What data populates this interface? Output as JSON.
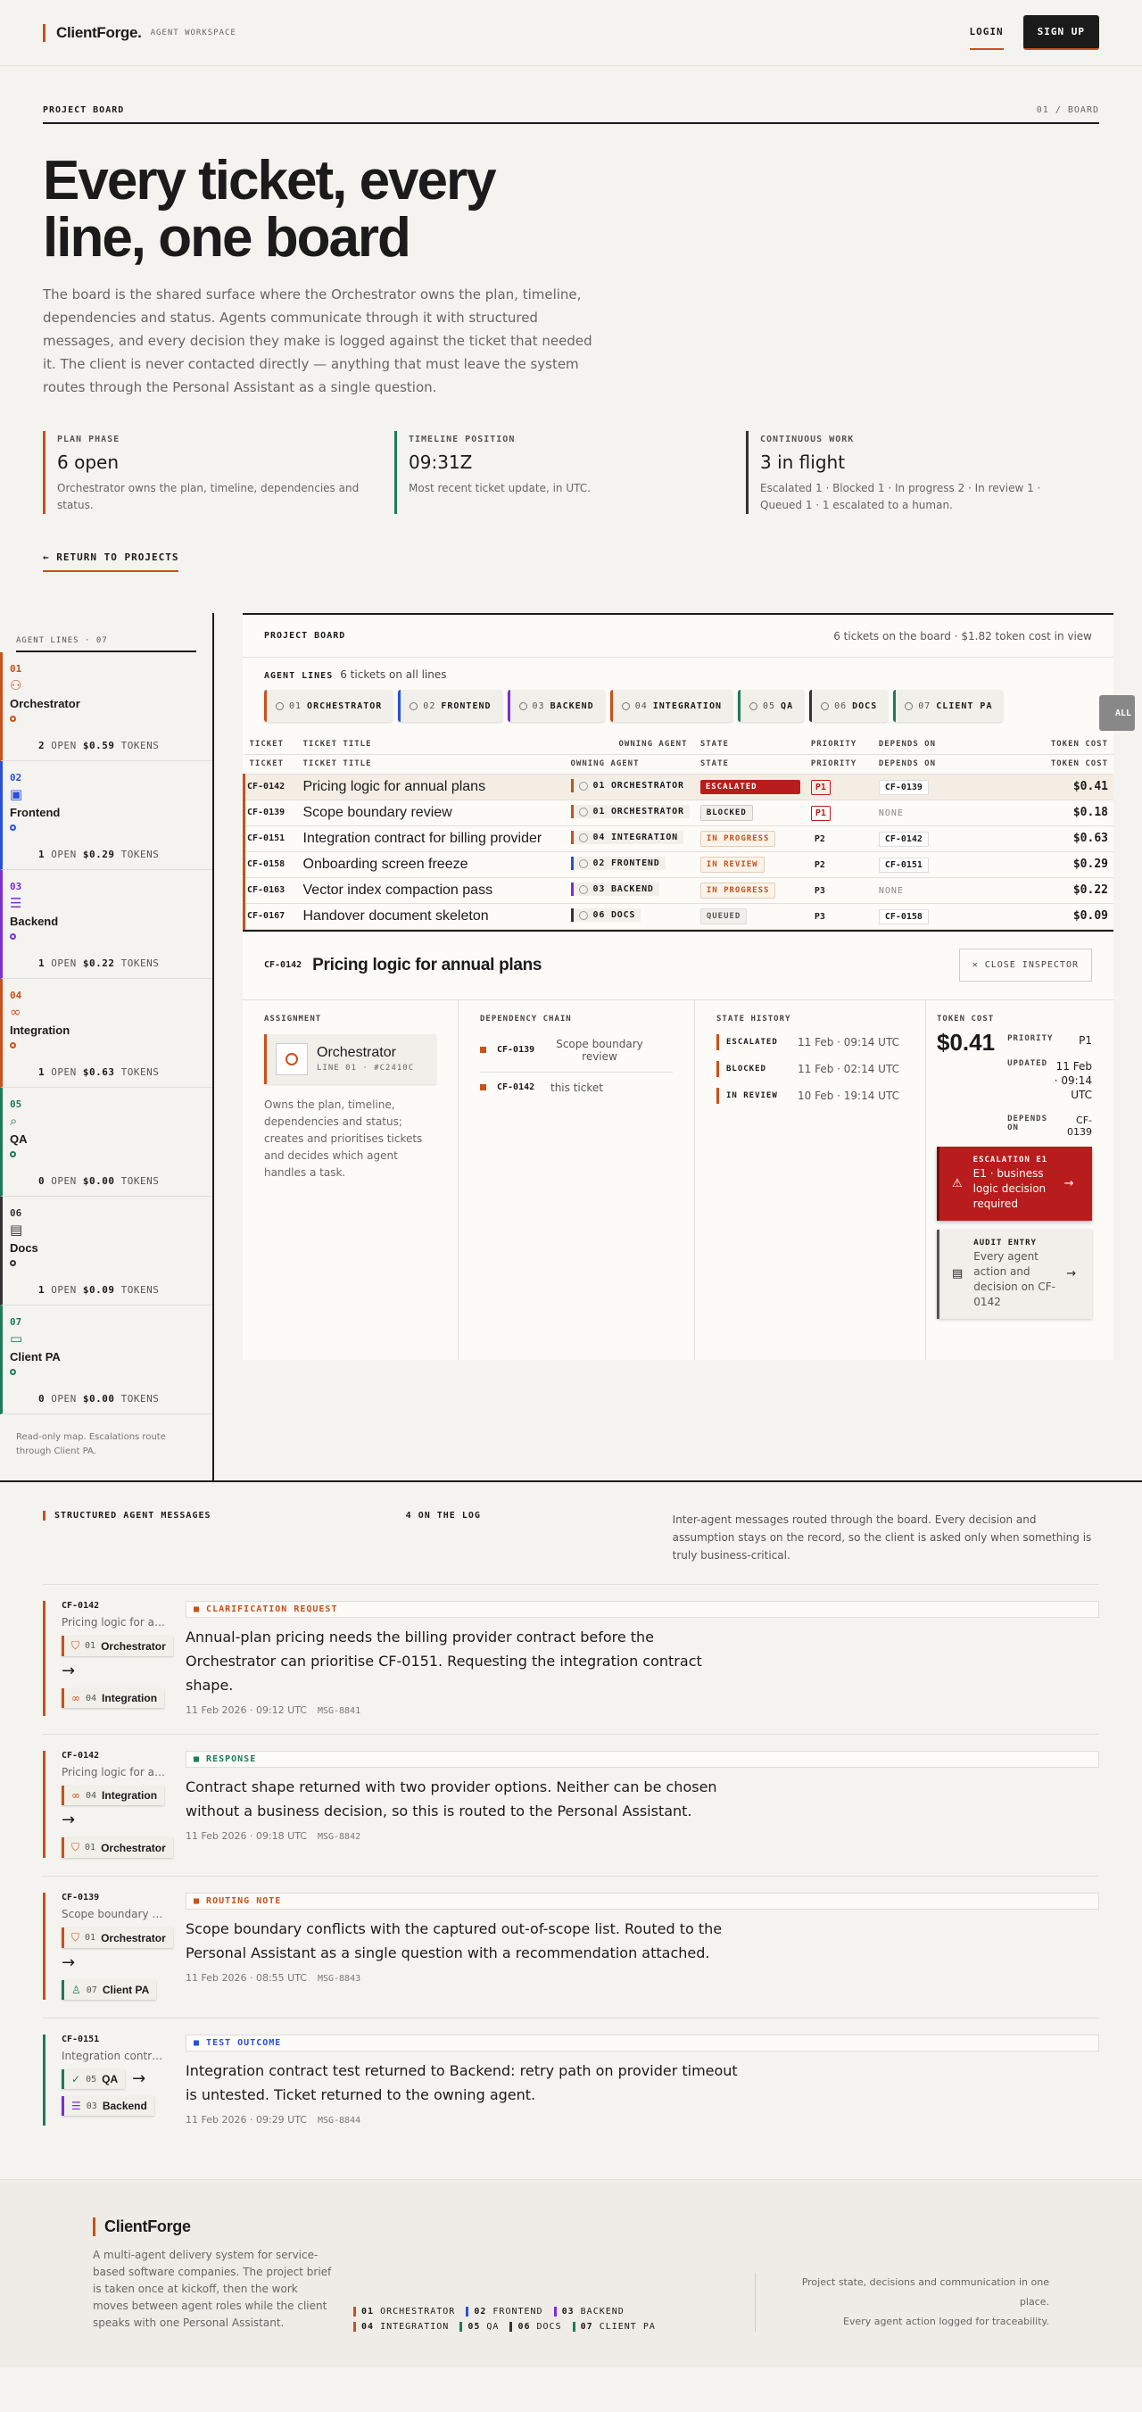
{
  "header": {
    "brand": "ClientForge.",
    "tag": "AGENT WORKSPACE",
    "login": "LOGIN",
    "signup": "SIGN UP"
  },
  "hero": {
    "section": "PROJECT BOARD",
    "section_right": "01 / BOARD",
    "title": "Every ticket, every line, one board",
    "lede": "The board is the shared surface where the Orchestrator owns the plan, timeline, dependencies and status. Agents communicate through it with structured messages, and every decision they make is logged against the ticket that needed it. The client is never contacted directly — anything that must leave the system routes through the Personal Assistant as a single question.",
    "stats": [
      {
        "k": "PLAN PHASE",
        "v": "6 open",
        "s": "Orchestrator owns the plan, timeline, dependencies and status."
      },
      {
        "k": "TIMELINE POSITION",
        "v": "09:31Z",
        "s": "Most recent ticket update, in UTC."
      },
      {
        "k": "CONTINUOUS WORK",
        "v": "3 in flight",
        "s": "Escalated 1 · Blocked 1 · In progress 2 · In review 1 · Queued 1 · 1 escalated to a human."
      }
    ],
    "back": "← RETURN TO PROJECTS"
  },
  "lines": {
    "heading": "AGENT LINES · 07",
    "note": "Read-only map. Escalations route through Client PA.",
    "agents": [
      {
        "n": "01",
        "name": "Orchestrator",
        "open": "2",
        "open_label": "OPEN",
        "tok": "$0.59",
        "tok_label": "TOKENS",
        "icon": "⚇",
        "color": "#c8511c"
      },
      {
        "n": "02",
        "name": "Frontend",
        "open": "1",
        "open_label": "OPEN",
        "tok": "$0.29",
        "tok_label": "TOKENS",
        "icon": "▣",
        "color": "#2a4fd8"
      },
      {
        "n": "03",
        "name": "Backend",
        "open": "1",
        "open_label": "OPEN",
        "tok": "$0.22",
        "tok_label": "TOKENS",
        "icon": "☰",
        "color": "#7b2fd1"
      },
      {
        "n": "04",
        "name": "Integration",
        "open": "1",
        "open_label": "OPEN",
        "tok": "$0.63",
        "tok_label": "TOKENS",
        "icon": "∞",
        "color": "#c8511c"
      },
      {
        "n": "05",
        "name": "QA",
        "open": "0",
        "open_label": "OPEN",
        "tok": "$0.00",
        "tok_label": "TOKENS",
        "icon": "⌕",
        "color": "#1f7a5b"
      },
      {
        "n": "06",
        "name": "Docs",
        "open": "1",
        "open_label": "OPEN",
        "tok": "$0.09",
        "tok_label": "TOKENS",
        "icon": "▤",
        "color": "#333333"
      },
      {
        "n": "07",
        "name": "Client PA",
        "open": "0",
        "open_label": "OPEN",
        "tok": "$0.00",
        "tok_label": "TOKENS",
        "icon": "▭",
        "color": "#1f7a5b"
      }
    ]
  },
  "board": {
    "title": "PROJECT BOARD",
    "summary": "6 tickets on the board · $1.82 token cost in view",
    "filter_label": "AGENT LINES",
    "filter_count": "6 tickets on all lines",
    "all": "ALL",
    "chips": [
      {
        "n": "01",
        "name": "ORCHESTRATOR",
        "color": "#c8511c"
      },
      {
        "n": "02",
        "name": "FRONTEND",
        "color": "#2a4fd8"
      },
      {
        "n": "03",
        "name": "BACKEND",
        "color": "#7b2fd1"
      },
      {
        "n": "04",
        "name": "INTEGRATION",
        "color": "#c8511c"
      },
      {
        "n": "05",
        "name": "QA",
        "color": "#1f7a5b"
      },
      {
        "n": "06",
        "name": "DOCS",
        "color": "#333333"
      },
      {
        "n": "07",
        "name": "CLIENT PA",
        "color": "#1f7a5b"
      }
    ],
    "columns": [
      "TICKET",
      "TICKET TITLE",
      "OWNING AGENT",
      "STATE",
      "PRIORITY",
      "DEPENDS ON",
      "TOKEN COST"
    ],
    "rows": [
      {
        "id": "CF-0142",
        "title": "Pricing logic for annual plans",
        "owner": "01 ORCHESTRATOR",
        "ocolor": "#c8511c",
        "state": "ESCALATED",
        "sc": "st-esc",
        "pri": "P1",
        "dep": "CF-0139",
        "cost": "$0.41",
        "rc": "#c8511c"
      },
      {
        "id": "CF-0139",
        "title": "Scope boundary review",
        "owner": "01 ORCHESTRATOR",
        "ocolor": "#c8511c",
        "state": "BLOCKED",
        "sc": "st-blk",
        "pri": "P1",
        "dep": "NONE",
        "cost": "$0.18",
        "rc": "#c8511c"
      },
      {
        "id": "CF-0151",
        "title": "Integration contract for billing provider",
        "owner": "04 INTEGRATION",
        "ocolor": "#c8511c",
        "state": "IN PROGRESS",
        "sc": "st-prog",
        "pri": "P2",
        "dep": "CF-0142",
        "cost": "$0.63",
        "rc": "#c8511c"
      },
      {
        "id": "CF-0158",
        "title": "Onboarding screen freeze",
        "owner": "02 FRONTEND",
        "ocolor": "#2a4fd8",
        "state": "IN REVIEW",
        "sc": "st-rev",
        "pri": "P2",
        "dep": "CF-0151",
        "cost": "$0.29",
        "rc": "#c8511c"
      },
      {
        "id": "CF-0163",
        "title": "Vector index compaction pass",
        "owner": "03 BACKEND",
        "ocolor": "#7b2fd1",
        "state": "IN PROGRESS",
        "sc": "st-prog",
        "pri": "P3",
        "dep": "NONE",
        "cost": "$0.22",
        "rc": "#c8511c"
      },
      {
        "id": "CF-0167",
        "title": "Handover document skeleton",
        "owner": "06 DOCS",
        "ocolor": "#333333",
        "state": "QUEUED",
        "sc": "st-q",
        "pri": "P3",
        "dep": "CF-0158",
        "cost": "$0.09",
        "rc": "#c8511c"
      }
    ]
  },
  "inspector": {
    "id": "CF-0142",
    "title": "Pricing logic for annual plans",
    "close": "CLOSE INSPECTOR",
    "assignment_h": "ASSIGNMENT",
    "agent": "Orchestrator",
    "agent_line": "LINE 01 · #C2410C",
    "agent_desc": "Owns the plan, timeline, dependencies and status; creates and prioritises tickets and decides which agent handles a task.",
    "dep_h": "DEPENDENCY CHAIN",
    "deps": [
      {
        "id": "CF-0139",
        "t": "Scope boundary review"
      },
      {
        "id": "CF-0142",
        "t": "this ticket"
      }
    ],
    "hist_h": "STATE HISTORY",
    "history": [
      {
        "s": "ESCALATED",
        "t": "11 Feb · 09:14 UTC"
      },
      {
        "s": "BLOCKED",
        "t": "11 Feb · 02:14 UTC"
      },
      {
        "s": "IN REVIEW",
        "t": "10 Feb · 19:14 UTC"
      }
    ],
    "cost_h": "TOKEN COST",
    "cost": "$0.41",
    "priority_k": "PRIORITY",
    "priority": "P1",
    "updated_k": "UPDATED",
    "updated": "11 Feb · 09:14 UTC",
    "depends_k": "DEPENDS ON",
    "depends": "CF-0139",
    "esc_title": "ESCALATION E1",
    "esc_desc": "E1 · business logic decision required",
    "audit_title": "AUDIT ENTRY",
    "audit_desc": "Every agent action and decision on CF-0142"
  },
  "messages": {
    "title": "STRUCTURED AGENT MESSAGES",
    "count": "4 ON THE LOG",
    "desc": "Inter-agent messages routed through the board. Every decision and assumption stays on the record, so the client is asked only when something is truly business-critical.",
    "items": [
      {
        "id": "CF-0142",
        "tl": "Pricing logic for annual plans",
        "from": {
          "n": "01",
          "nm": "Orchestrator",
          "c": "#c8511c",
          "i": "⛉"
        },
        "to": {
          "n": "04",
          "nm": "Integration",
          "c": "#c8511c",
          "i": "∞"
        },
        "type": "CLARIFICATION REQUEST",
        "tc": "#c8511c",
        "text": "Annual-plan pricing needs the billing provider contract before the Orchestrator can prioritise CF-0151. Requesting the integration contract shape.",
        "time": "11 Feb 2026 · 09:12 UTC",
        "ref": "MSG-8841",
        "lc": "#c8511c"
      },
      {
        "id": "CF-0142",
        "tl": "Pricing logic for annual plans",
        "from": {
          "n": "04",
          "nm": "Integration",
          "c": "#c8511c",
          "i": "∞"
        },
        "to": {
          "n": "01",
          "nm": "Orchestrator",
          "c": "#c8511c",
          "i": "⛉"
        },
        "type": "RESPONSE",
        "tc": "#1f7a5b",
        "text": "Contract shape returned with two provider options. Neither can be chosen without a business decision, so this is routed to the Personal Assistant.",
        "time": "11 Feb 2026 · 09:18 UTC",
        "ref": "MSG-8842",
        "lc": "#c8511c"
      },
      {
        "id": "CF-0139",
        "tl": "Scope boundary review",
        "from": {
          "n": "01",
          "nm": "Orchestrator",
          "c": "#c8511c",
          "i": "⛉"
        },
        "to": {
          "n": "07",
          "nm": "Client PA",
          "c": "#1f7a5b",
          "i": "♙"
        },
        "type": "ROUTING NOTE",
        "tc": "#c8511c",
        "text": "Scope boundary conflicts with the captured out-of-scope list. Routed to the Personal Assistant as a single question with a recommendation attached.",
        "time": "11 Feb 2026 · 08:55 UTC",
        "ref": "MSG-8843",
        "lc": "#c8511c"
      },
      {
        "id": "CF-0151",
        "tl": "Integration contract for billing provider",
        "from": {
          "n": "05",
          "nm": "QA",
          "c": "#1f7a5b",
          "i": "✓"
        },
        "to": {
          "n": "03",
          "nm": "Backend",
          "c": "#7b2fd1",
          "i": "☰"
        },
        "type": "TEST OUTCOME",
        "tc": "#2a4fd8",
        "text": "Integration contract test returned to Backend: retry path on provider timeout is untested. Ticket returned to the owning agent.",
        "time": "11 Feb 2026 · 09:29 UTC",
        "ref": "MSG-8844",
        "lc": "#1f7a5b",
        "inline": true
      }
    ]
  },
  "footer": {
    "brand": "ClientForge",
    "desc": "A multi-agent delivery system for service-based software companies. The project brief is taken once at kickoff, then the work moves between agent roles while the client speaks with one Personal Assistant.",
    "lines": [
      {
        "n": "01",
        "nm": "ORCHESTRATOR",
        "c": "#c8511c"
      },
      {
        "n": "02",
        "nm": "FRONTEND",
        "c": "#2a4fd8"
      },
      {
        "n": "03",
        "nm": "BACKEND",
        "c": "#7b2fd1"
      },
      {
        "n": "04",
        "nm": "INTEGRATION",
        "c": "#c8511c"
      },
      {
        "n": "05",
        "nm": "QA",
        "c": "#1f7a5b"
      },
      {
        "n": "06",
        "nm": "DOCS",
        "c": "#333333"
      },
      {
        "n": "07",
        "nm": "CLIENT PA",
        "c": "#1f7a5b"
      }
    ],
    "r1": "Project state, decisions and communication in one place.",
    "r2": "Every agent action logged for traceability."
  }
}
